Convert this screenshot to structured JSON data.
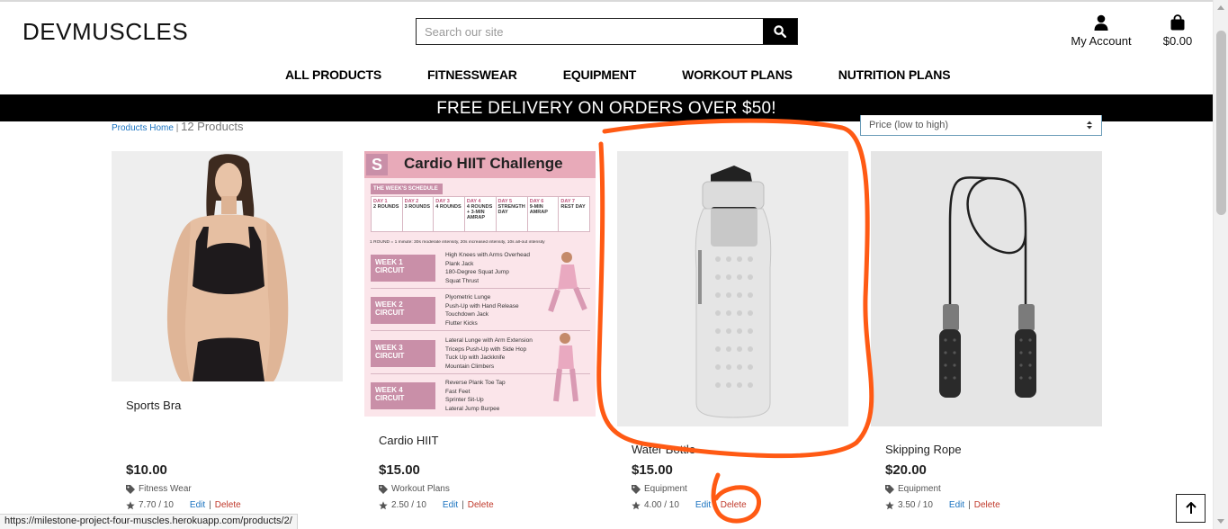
{
  "header": {
    "logo": "DEVMUSCLES",
    "search_placeholder": "Search our site",
    "account_label": "My Account",
    "bag_total": "$0.00"
  },
  "nav": [
    "ALL PRODUCTS",
    "FITNESSWEAR",
    "EQUIPMENT",
    "WORKOUT PLANS",
    "NUTRITION PLANS"
  ],
  "banner": "FREE DELIVERY ON ORDERS OVER $50!",
  "breadcrumb": {
    "link": "Products Home",
    "separator": "|",
    "count": "12 Products"
  },
  "sort": {
    "selected": "Price (low to high)"
  },
  "products": [
    {
      "name": "Sports Bra",
      "price": "$10.00",
      "category": "Fitness Wear",
      "rating": "7.70 / 10",
      "edit": "Edit",
      "delete": "Delete"
    },
    {
      "name": "Cardio HIIT",
      "price": "$15.00",
      "category": "Workout Plans",
      "rating": "2.50 / 10",
      "edit": "Edit",
      "delete": "Delete"
    },
    {
      "name": "Water Bottle",
      "price": "$15.00",
      "category": "Equipment",
      "rating": "4.00 / 10",
      "edit": "Edit",
      "delete": "Delete"
    },
    {
      "name": "Skipping Rope",
      "price": "$20.00",
      "category": "Equipment",
      "rating": "3.50 / 10",
      "edit": "Edit",
      "delete": "Delete"
    }
  ],
  "hiit_poster": {
    "badge": "S",
    "title": "Cardio HIIT Challenge",
    "schedule_label": "THE WEEK'S SCHEDULE",
    "days": [
      {
        "day": "DAY 1",
        "desc": "2 ROUNDS"
      },
      {
        "day": "DAY 2",
        "desc": "3 ROUNDS"
      },
      {
        "day": "DAY 3",
        "desc": "4 ROUNDS"
      },
      {
        "day": "DAY 4",
        "desc": "4 ROUNDS + 3-MIN AMRAP"
      },
      {
        "day": "DAY 5",
        "desc": "STRENGTH DAY"
      },
      {
        "day": "DAY 6",
        "desc": "9-MIN AMRAP"
      },
      {
        "day": "DAY 7",
        "desc": "REST DAY"
      }
    ],
    "round_note": "1 ROUND = 1 minute: 30s moderate intensity, 20s increased intensity, 10s all-out intensity",
    "weeks": [
      {
        "label": "WEEK 1 CIRCUIT",
        "moves": [
          "High Knees with Arms Overhead",
          "Plank Jack",
          "180-Degree Squat Jump",
          "Squat Thrust"
        ]
      },
      {
        "label": "WEEK 2 CIRCUIT",
        "moves": [
          "Plyometric Lunge",
          "Push-Up with Hand Release",
          "Touchdown Jack",
          "Flutter Kicks"
        ]
      },
      {
        "label": "WEEK 3 CIRCUIT",
        "moves": [
          "Lateral Lunge with Arm Extension",
          "Triceps Push-Up with Side Hop",
          "Tuck Up with Jackknife",
          "Mountain Climbers"
        ]
      },
      {
        "label": "WEEK 4 CIRCUIT",
        "moves": [
          "Reverse Plank Toe Tap",
          "Fast Feet",
          "Sprinter Sit-Up",
          "Lateral Jump Burpee"
        ]
      }
    ]
  },
  "status_bar": "https://milestone-project-four-muscles.herokuapp.com/products/2/",
  "colors": {
    "link": "#1a73c0",
    "delete": "#c0392b",
    "annotation": "#ff5a14",
    "poster_bg": "#fbe5ea",
    "poster_accent": "#c98fa8"
  }
}
